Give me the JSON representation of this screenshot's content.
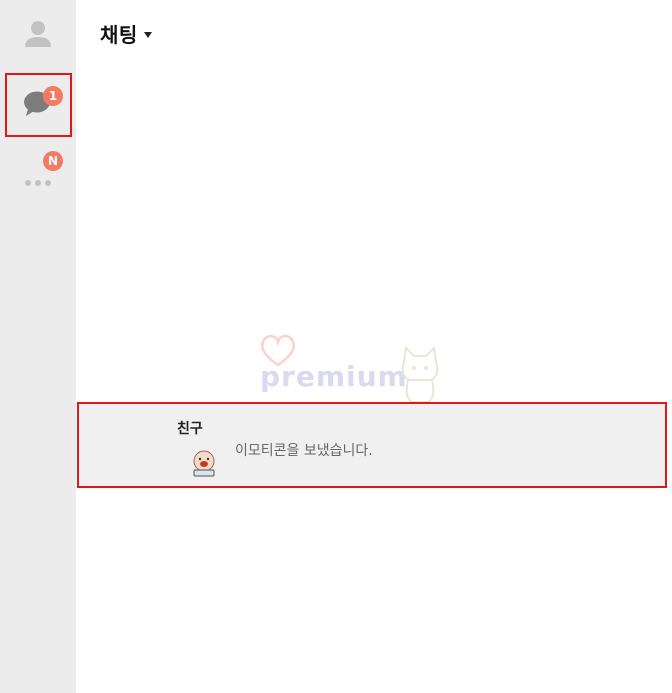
{
  "sidebar": {
    "items": [
      {
        "name": "friends",
        "icon": "person-icon"
      },
      {
        "name": "chats",
        "icon": "chat-bubble-icon",
        "badge": "1"
      },
      {
        "name": "more",
        "icon": "more-dots-icon",
        "badge": "N"
      }
    ]
  },
  "header": {
    "title": "채팅"
  },
  "chat_list": [
    {
      "name": "친구",
      "preview": "이모티콘을 보냈습니다.",
      "avatar_icon": "emoticon-character-icon"
    }
  ],
  "watermark": {
    "text": "premium"
  },
  "colors": {
    "sidebar_bg": "#ececec",
    "badge": "#f47a66",
    "highlight_border": "#e01818",
    "selected_row": "#f0f0f0"
  }
}
